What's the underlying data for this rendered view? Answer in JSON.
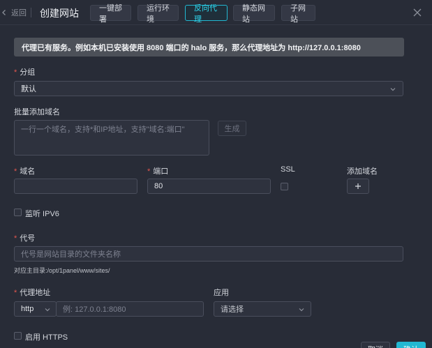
{
  "header": {
    "back_label": "返回",
    "title": "创建网站",
    "tabs": [
      {
        "label": "一键部署",
        "active": false
      },
      {
        "label": "运行环境",
        "active": false
      },
      {
        "label": "反向代理",
        "active": true
      },
      {
        "label": "静态网站",
        "active": false
      },
      {
        "label": "子网站",
        "active": false
      }
    ]
  },
  "notice": "代理已有服务。例如本机已安装使用 8080 端口的 halo 服务，那么代理地址为 http://127.0.0.1:8080",
  "group": {
    "label": "分组",
    "value": "默认"
  },
  "bulk_domains": {
    "label": "批量添加域名",
    "placeholder": "一行一个域名，支持*和IP地址，支持\"域名:端口\"",
    "generate_button": "生成"
  },
  "domain_row": {
    "domain_label": "域名",
    "domain_value": "",
    "port_label": "端口",
    "port_value": "80",
    "ssl_label": "SSL",
    "add_domain_label": "添加域名"
  },
  "ipv6": {
    "label": "监听 IPV6"
  },
  "alias": {
    "label": "代号",
    "placeholder": "代号是网站目录的文件夹名称",
    "path_hint": "对应主目录:/opt/1panel/www/sites/"
  },
  "proxy": {
    "label": "代理地址",
    "protocol": "http",
    "address_placeholder": "例: 127.0.0.1:8080",
    "app_label": "应用",
    "app_placeholder": "请选择"
  },
  "https": {
    "label": "启用 HTTPS"
  },
  "footer": {
    "cancel": "取消",
    "confirm": "确认"
  },
  "colors": {
    "background": "#282c37",
    "accent": "#22b8d2",
    "required": "#e4574f"
  }
}
